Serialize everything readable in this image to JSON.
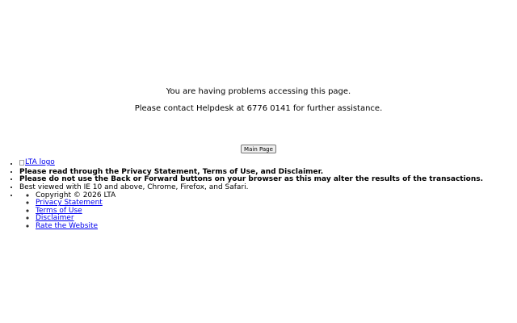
{
  "error": {
    "line1": "You are having problems accessing this page.",
    "line2": "Please contact Helpdesk at 6776 0141 for further assistance."
  },
  "main_page_button": "Main Page",
  "footer": {
    "logo_alt": "LTA logo",
    "notice_privacy": "Please read through the Privacy Statement, Terms of Use, and Disclaimer.",
    "notice_back_forward": "Please do not use the Back or Forward buttons on your browser as this may alter the results of the transactions.",
    "browser_note": "Best viewed with IE 10 and above, Chrome, Firefox, and Safari.",
    "copyright": "Copyright © 2026 LTA",
    "links": {
      "privacy": "Privacy Statement",
      "terms": "Terms of Use",
      "disclaimer": "Disclaimer",
      "rate": "Rate the Website"
    }
  }
}
